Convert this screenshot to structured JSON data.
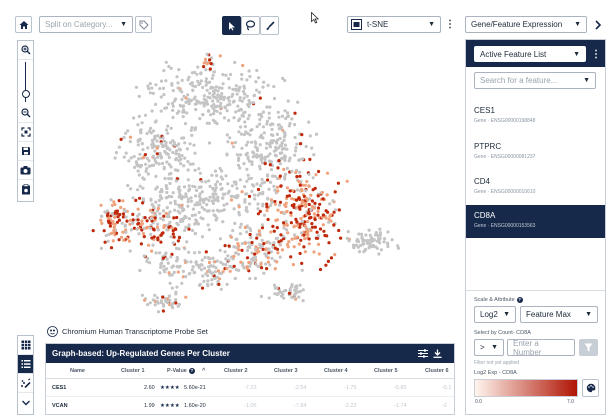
{
  "toolbar": {
    "split_placeholder": "Split on Category...",
    "projection_label": "t-SNE",
    "mode_label": "Gene/Feature Expression"
  },
  "dataset_label": "Chromium Human Transcriptome Probe Set",
  "panel": {
    "list_label": "Active Feature List",
    "search_placeholder": "Search for a feature...",
    "features": [
      {
        "name": "CES1",
        "id": "Gene · ENSG00000198848"
      },
      {
        "name": "PTPRC",
        "id": "Gene · ENSG00000081237"
      },
      {
        "name": "CD4",
        "id": "Gene · ENSG00000010610"
      },
      {
        "name": "CD8A",
        "id": "Gene · ENSG00000153563"
      }
    ],
    "selected_index": 3,
    "scale_label": "Scale & Attribute",
    "scale_value": "Log2",
    "attribute_value": "Feature Max",
    "count_label": "Select by Count- CD8A",
    "operator_value": ">",
    "number_placeholder": "Enter a Number",
    "filter_status": "Filter not yet applied",
    "legend_label": "Log2 Exp - CD8A",
    "legend_min": "0.0",
    "legend_max": "7.0",
    "legend_colors": [
      "#fff5ee",
      "#b01404"
    ]
  },
  "table": {
    "title": "Graph-based: Up-Regulated Genes Per Cluster",
    "headers": [
      "Name",
      "Cluster 1",
      "P-Value",
      "Cluster 2",
      "Cluster 3",
      "Cluster 4",
      "Cluster 5",
      "Cluster 6"
    ],
    "rows": [
      {
        "name": "CES1",
        "c1": "2.60",
        "stars": "★★★★",
        "pval": "5.60e-21",
        "others": [
          "-7.23",
          "-2.54",
          "-1.75",
          "-5.85",
          "-5.1"
        ]
      },
      {
        "name": "VCAN",
        "c1": "1.99",
        "stars": "★★★★",
        "pval": "1.60e-20",
        "others": [
          "-1.06",
          "-7.84",
          "-2.23",
          "-1.74",
          "-2"
        ]
      }
    ]
  },
  "colors": {
    "navy": "#17294a",
    "point_grey": "#c4c4c4",
    "point_low": "#f0a27c",
    "point_high": "#c0290c"
  }
}
